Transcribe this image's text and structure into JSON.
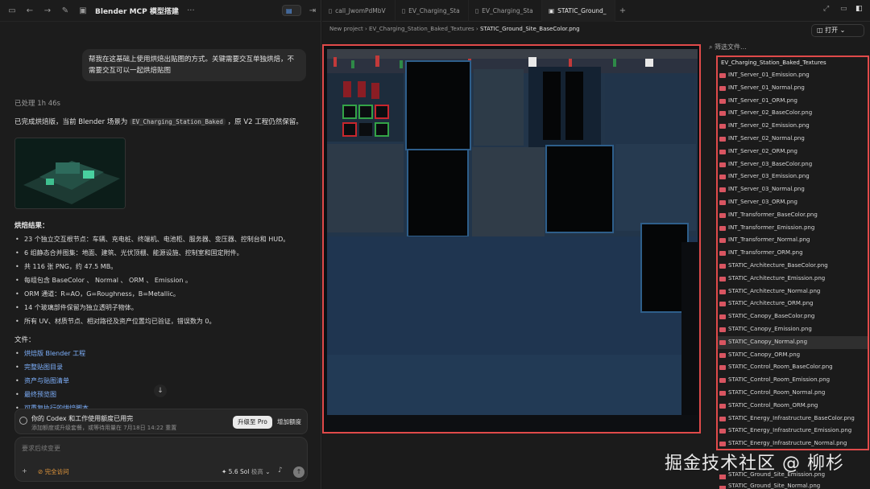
{
  "left_header": {
    "title": "Blender MCP 模型搭建"
  },
  "user_message": "帮我在这基础上使用烘焙出贴图的方式。关键需要交互单独烘焙，不需要交互可以一起烘焙贴图",
  "processed": "已处理 1h 46s",
  "summary": {
    "prefix": "已完成烘焙版，当前 Blender 场景为",
    "code": "EV_Charging_Station_Baked",
    "suffix": "，原 V2 工程仍然保留。"
  },
  "results_heading": "烘焙结果：",
  "results": [
    "23 个独立交互根节点：车辆、充电桩、终端机、电池柜、服务器、变压器、控制台和 HUD。",
    "6 组静态合并图集：地面、建筑、光伏顶棚、能源设施、控制室和固定附件。",
    "共 116 张 PNG，约 47.5 MB。",
    "每组包含 BaseColor 、 Normal 、 ORM 、 Emission 。",
    "ORM 通道：R=AO，G=Roughness，B=Metallic。",
    "14 个玻璃部件保留为独立透明子物体。",
    "所有 UV、材质节点、相对路径及资产位置均已验证，错误数为 0。"
  ],
  "files_heading": "文件：",
  "files": [
    "烘焙版 Blender 工程",
    "完整贴图目录",
    "资产与贴图清单",
    "最终预览图",
    "可重复执行的烘焙脚本"
  ],
  "banner": {
    "title": "你的 Codex 和工作使用额度已用完",
    "subtitle": "添加额度或升级套餐，或等待用量在 7月18日 14:22 重置",
    "upgrade": "升级至 Pro",
    "add": "增加额度"
  },
  "composer": {
    "placeholder": "要求后续变更",
    "access": "完全访问",
    "model": "5.6 Sol",
    "model_suffix": "极高"
  },
  "tabs": [
    "call_JwomPdMbV",
    "EV_Charging_Sta",
    "EV_Charging_Sta",
    "STATIC_Ground_"
  ],
  "breadcrumb": [
    "New project",
    "EV_Charging_Station_Baked_Textures",
    "STATIC_Ground_Site_BaseColor.png"
  ],
  "open_button": "打开",
  "filter_placeholder": "筛选文件...",
  "folder": "EV_Charging_Station_Baked_Textures",
  "file_items": [
    "INT_Server_01_Emission.png",
    "INT_Server_01_Normal.png",
    "INT_Server_01_ORM.png",
    "INT_Server_02_BaseColor.png",
    "INT_Server_02_Emission.png",
    "INT_Server_02_Normal.png",
    "INT_Server_02_ORM.png",
    "INT_Server_03_BaseColor.png",
    "INT_Server_03_Emission.png",
    "INT_Server_03_Normal.png",
    "INT_Server_03_ORM.png",
    "INT_Transformer_BaseColor.png",
    "INT_Transformer_Emission.png",
    "INT_Transformer_Normal.png",
    "INT_Transformer_ORM.png",
    "STATIC_Architecture_BaseColor.png",
    "STATIC_Architecture_Emission.png",
    "STATIC_Architecture_Normal.png",
    "STATIC_Architecture_ORM.png",
    "STATIC_Canopy_BaseColor.png",
    "STATIC_Canopy_Emission.png",
    "STATIC_Canopy_Normal.png",
    "STATIC_Canopy_ORM.png",
    "STATIC_Control_Room_BaseColor.png",
    "STATIC_Control_Room_Emission.png",
    "STATIC_Control_Room_Normal.png",
    "STATIC_Control_Room_ORM.png",
    "STATIC_Energy_Infrastructure_BaseColor.png",
    "STATIC_Energy_Infrastructure_Emission.png",
    "STATIC_Energy_Infrastructure_Normal.png",
    "STATIC_Energy_Infrastructure_ORM.png"
  ],
  "selected_file": "STATIC_Canopy_Normal.png",
  "below_items": [
    "STATIC_Ground_Site_Emission.png",
    "STATIC_Ground_Site_Normal.png"
  ],
  "watermark": "掘金技术社区 @ 柳杉",
  "colors": {
    "highlight": "#e04a4a",
    "link": "#7fb2ff",
    "access": "#e89a3c"
  }
}
